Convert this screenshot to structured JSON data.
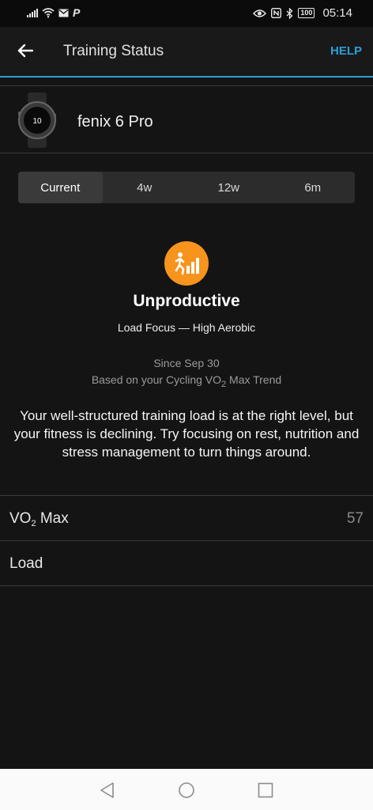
{
  "status_bar": {
    "time": "05:14",
    "battery": "100"
  },
  "header": {
    "title": "Training Status",
    "help": "HELP"
  },
  "device": {
    "name": "fenix 6 Pro",
    "watch_face_value": "10"
  },
  "tabs": [
    {
      "label": "Current",
      "active": true
    },
    {
      "label": "4w",
      "active": false
    },
    {
      "label": "12w",
      "active": false
    },
    {
      "label": "6m",
      "active": false
    }
  ],
  "status": {
    "title": "Unproductive",
    "load_focus": "Load Focus — High Aerobic",
    "since": "Since Sep 30",
    "based_on_prefix": "Based on your Cycling VO",
    "based_on_sub": "2",
    "based_on_suffix": " Max Trend",
    "description": "Your well-structured training load is at the right level, but your fitness is declining. Try focusing on rest, nutrition and stress management to turn things around.",
    "icon": "running-bars-icon",
    "icon_color": "#f7941d"
  },
  "rows": {
    "vo2": {
      "label_prefix": "VO",
      "label_sub": "2",
      "label_suffix": " Max",
      "value": "57"
    },
    "load": {
      "label": "Load"
    }
  },
  "colors": {
    "accent": "#2a9fd8",
    "background": "#141414"
  }
}
